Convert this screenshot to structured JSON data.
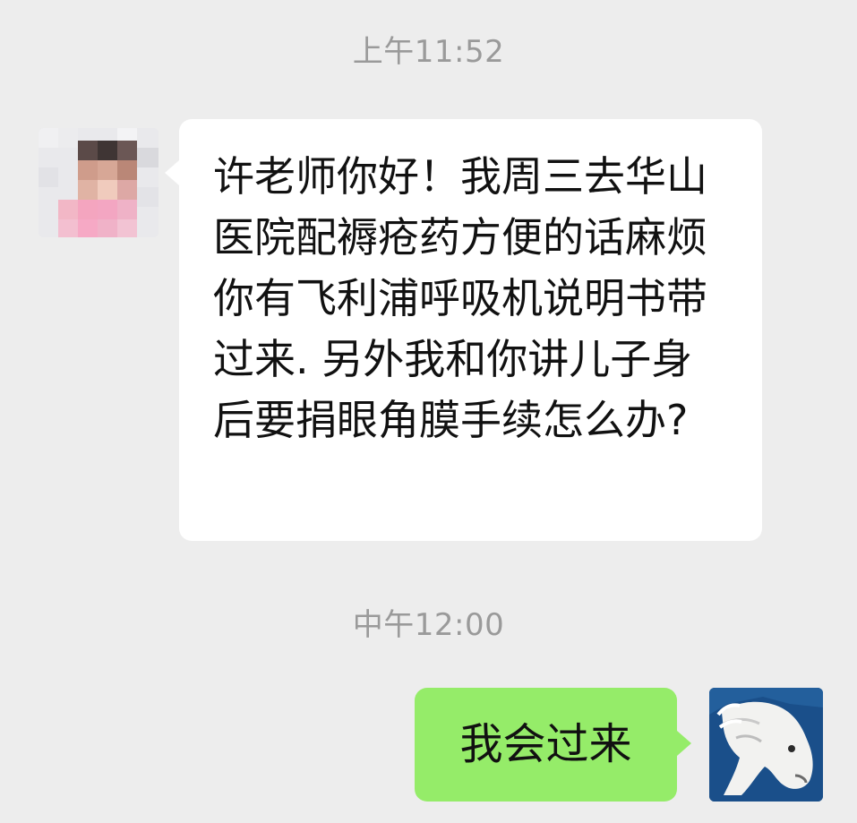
{
  "chat": {
    "timestamps": [
      "上午11:52",
      "中午12:00"
    ],
    "messages": [
      {
        "sender": "other",
        "text": "许老师你好！我周三去华山医院配褥疮药方便的话麻烦你有飞利浦呼吸机说明书带过来. 另外我和你讲儿子身后要捐眼角膜手续怎么办?"
      },
      {
        "sender": "me",
        "text": "我会过来"
      }
    ]
  },
  "colors": {
    "background": "#ededed",
    "incoming_bubble": "#ffffff",
    "outgoing_bubble": "#95ec69",
    "timestamp_text": "#9a9a9a"
  },
  "icons": {
    "left_avatar": "blurred-profile-photo",
    "right_avatar": "white-horse-painting"
  }
}
